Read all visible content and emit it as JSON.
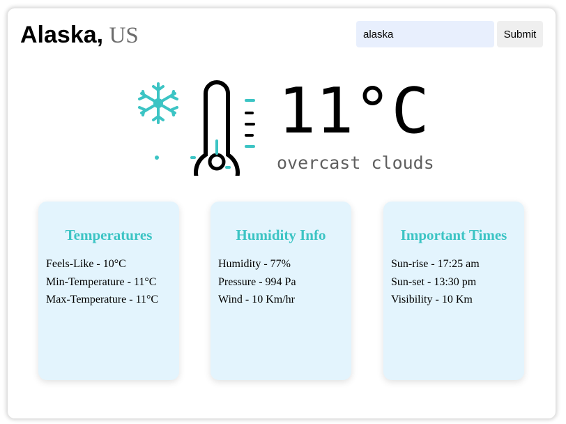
{
  "header": {
    "city": "Alaska,",
    "country": "US"
  },
  "search": {
    "value": "alaska",
    "submit_label": "Submit"
  },
  "current": {
    "temperature": "11°C",
    "description": "overcast clouds",
    "icon": "snowflake-thermometer-icon"
  },
  "colors": {
    "accent": "#3cc4c4",
    "card_bg": "#e3f4fd",
    "input_bg": "#e8effd"
  },
  "cards": [
    {
      "title": "Temperatures",
      "items": [
        "Feels-Like - 10°C",
        "Min-Temperature - 11°C",
        "Max-Temperature - 11°C"
      ]
    },
    {
      "title": "Humidity Info",
      "items": [
        "Humidity - 77%",
        "Pressure - 994 Pa",
        "Wind - 10 Km/hr"
      ]
    },
    {
      "title": "Important Times",
      "items": [
        "Sun-rise - 17:25 am",
        "Sun-set - 13:30 pm",
        "Visibility - 10 Km"
      ]
    }
  ]
}
